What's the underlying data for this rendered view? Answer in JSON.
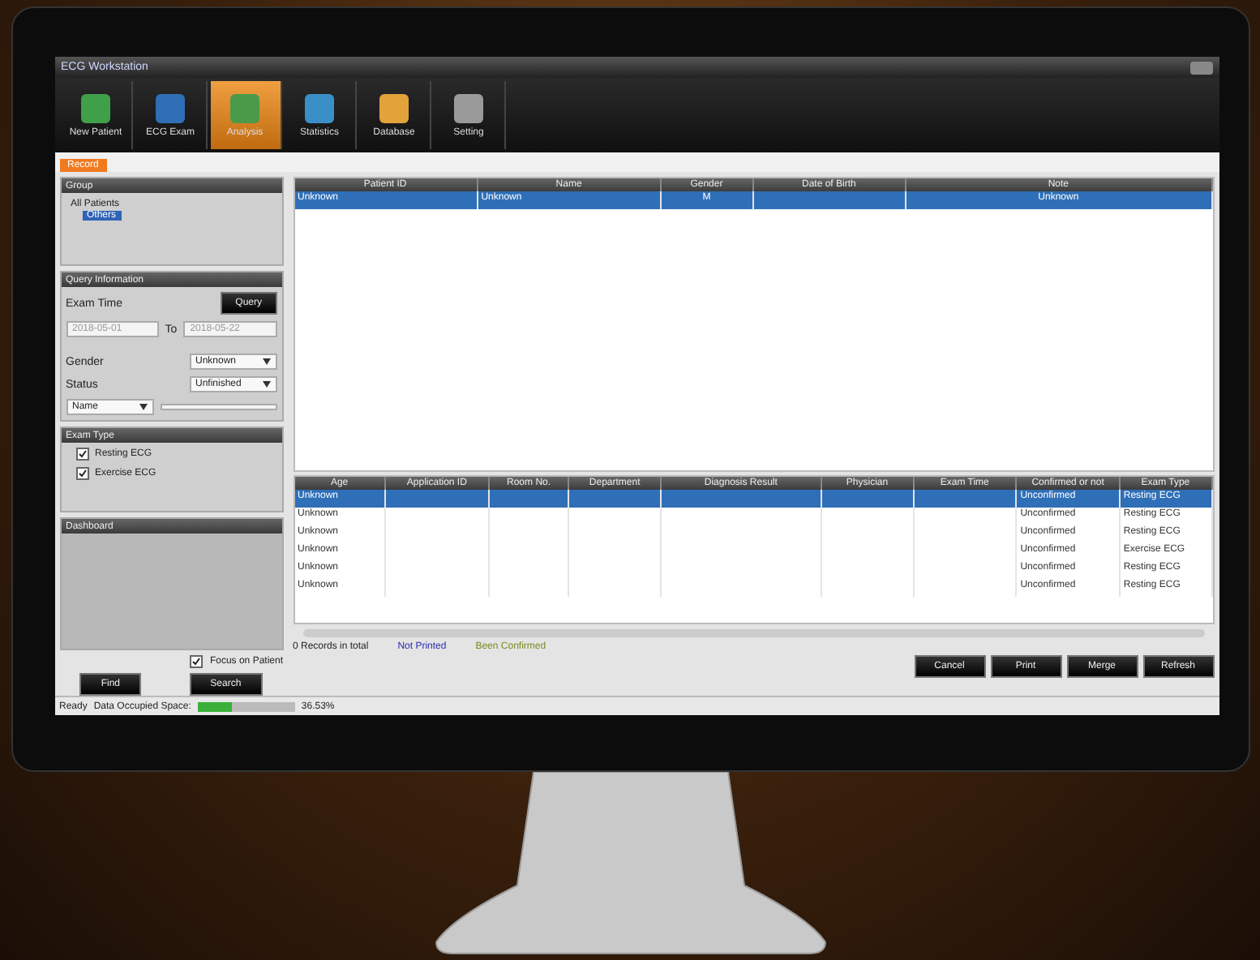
{
  "window": {
    "title": "ECG Workstation"
  },
  "toolbar": [
    {
      "label": "New Patient",
      "selected": false,
      "color": "#3fa04a"
    },
    {
      "label": "ECG Exam",
      "selected": false,
      "color": "#2f6fb5"
    },
    {
      "label": "Analysis",
      "selected": true,
      "color": "#4a9a4a"
    },
    {
      "label": "Statistics",
      "selected": false,
      "color": "#3b8fc8"
    },
    {
      "label": "Database",
      "selected": false,
      "color": "#e2a33a"
    },
    {
      "label": "Setting",
      "selected": false,
      "color": "#9a9a9a"
    }
  ],
  "page_tab": {
    "label": "Record"
  },
  "sidebar": {
    "group": {
      "title": "Group",
      "tree": [
        {
          "label": "All Patients",
          "selected": false,
          "children": [
            {
              "label": "Others",
              "selected": true
            }
          ]
        }
      ]
    },
    "query": {
      "title": "Query Information",
      "exam_time_label": "Exam Time",
      "query_button": "Query",
      "date_from": "2018-05-01",
      "to_label": "To",
      "date_to": "2018-05-22",
      "gender_label": "Gender",
      "gender": "Unknown",
      "status_label": "Status",
      "status": "Unfinished",
      "name_field": "Name"
    },
    "exam_type": {
      "title": "Exam Type",
      "items": [
        {
          "label": "Resting ECG",
          "checked": true
        },
        {
          "label": "Exercise ECG",
          "checked": true
        }
      ]
    },
    "dashboard": {
      "title": "Dashboard"
    },
    "focus": {
      "label": "Focus on Patient",
      "checked": true
    },
    "buttons": [
      "Find",
      "Search"
    ]
  },
  "patients": {
    "columns": [
      "Patient ID",
      "Name",
      "Gender",
      "Date of Birth",
      "Note"
    ],
    "rows": [
      {
        "selected": true,
        "cells": [
          "Unknown",
          "Unknown",
          "M",
          "",
          "Unknown"
        ]
      }
    ]
  },
  "records": {
    "columns": [
      "Age",
      "Application ID",
      "Room No.",
      "Department",
      "Diagnosis Result",
      "Physician",
      "Exam Time",
      "Confirmed or not",
      "Exam Type"
    ],
    "rows": [
      {
        "selected": true,
        "cells": [
          "Unknown",
          "",
          "",
          "",
          "",
          "",
          "",
          "Unconfirmed",
          "Resting ECG"
        ]
      },
      {
        "selected": false,
        "cells": [
          "Unknown",
          "",
          "",
          "",
          "",
          "",
          "",
          "Unconfirmed",
          "Resting ECG"
        ]
      },
      {
        "selected": false,
        "cells": [
          "Unknown",
          "",
          "",
          "",
          "",
          "",
          "",
          "Unconfirmed",
          "Resting ECG"
        ]
      },
      {
        "selected": false,
        "cells": [
          "Unknown",
          "",
          "",
          "",
          "",
          "",
          "",
          "Unconfirmed",
          "Exercise ECG"
        ]
      },
      {
        "selected": false,
        "cells": [
          "Unknown",
          "",
          "",
          "",
          "",
          "",
          "",
          "Unconfirmed",
          "Resting ECG"
        ]
      },
      {
        "selected": false,
        "cells": [
          "Unknown",
          "",
          "",
          "",
          "",
          "",
          "",
          "Unconfirmed",
          "Resting ECG"
        ]
      }
    ]
  },
  "legend": [
    {
      "label": "0 Records in total",
      "color": "#222222"
    },
    {
      "label": "Not Printed",
      "color": "#2a2ab0"
    },
    {
      "label": "Been Confirmed",
      "color": "#7a8a20"
    }
  ],
  "actions": [
    "Cancel",
    "Print",
    "Merge",
    "Refresh"
  ],
  "status_bar": {
    "ready": "Ready",
    "space_label": "Data Occupied Space:",
    "level": 0.36,
    "reading": "36.53%"
  }
}
